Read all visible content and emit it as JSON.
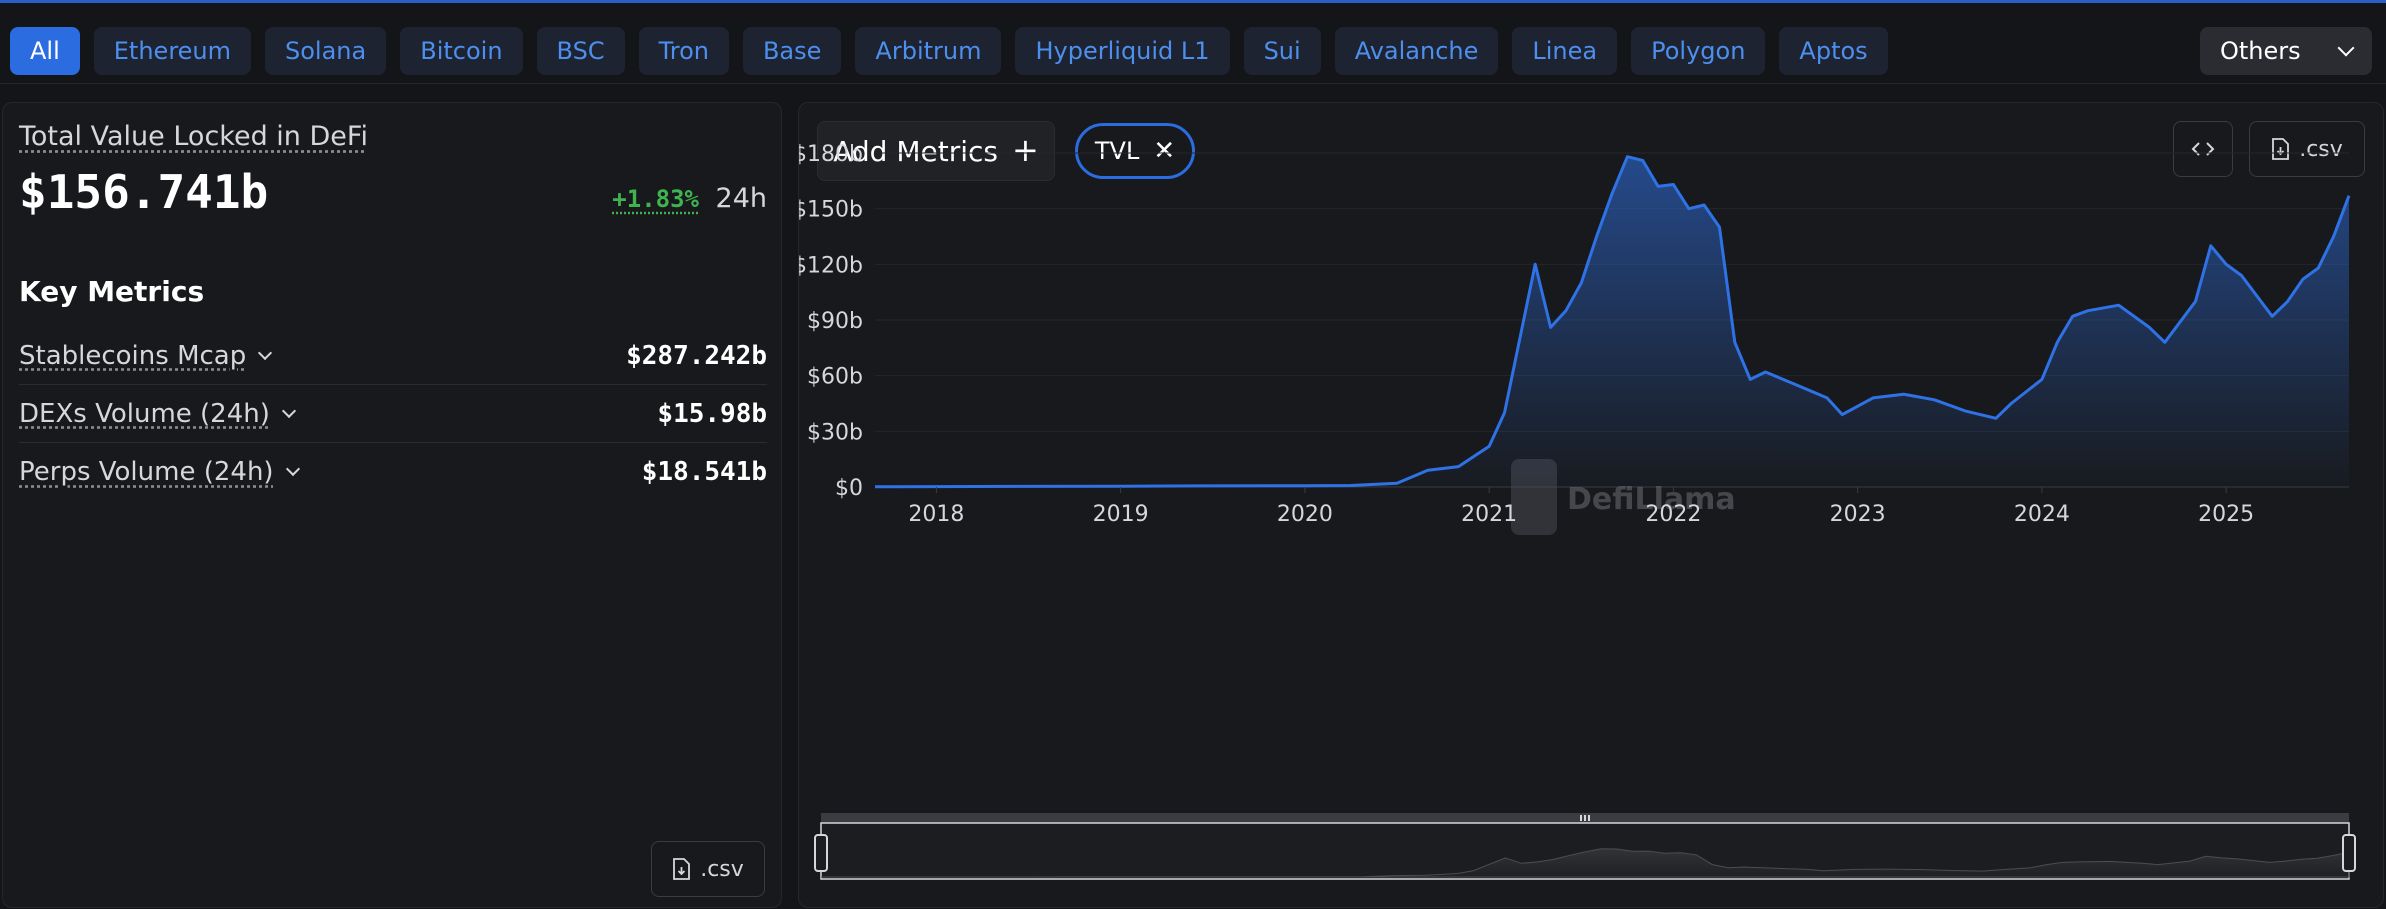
{
  "chains": {
    "items": [
      "All",
      "Ethereum",
      "Solana",
      "Bitcoin",
      "BSC",
      "Tron",
      "Base",
      "Arbitrum",
      "Hyperliquid L1",
      "Sui",
      "Avalanche",
      "Linea",
      "Polygon",
      "Aptos"
    ],
    "active": "All",
    "others_label": "Others"
  },
  "summary": {
    "tvl_label": "Total Value Locked in DeFi",
    "tvl_value": "$156.741b",
    "change": "+1.83%",
    "period": "24h"
  },
  "key_metrics": {
    "title": "Key Metrics",
    "rows": [
      {
        "name": "Stablecoins Mcap",
        "value": "$287.242b"
      },
      {
        "name": "DEXs Volume (24h)",
        "value": "$15.98b"
      },
      {
        "name": "Perps Volume (24h)",
        "value": "$18.541b"
      }
    ]
  },
  "buttons": {
    "csv_label": ".csv",
    "add_metrics_label": "Add Metrics",
    "tvl_chip_label": "TVL"
  },
  "icons": {
    "download": "download-file-icon",
    "embed": "code-brackets-icon",
    "plus": "plus-icon",
    "close": "close-icon",
    "chevron": "chevron-down-icon"
  },
  "colors": {
    "accent": "#2b6de0",
    "line": "#2f72e6",
    "positive": "#3fb34f",
    "tab_text": "#4d8fee"
  },
  "watermark": "DefiLlama",
  "chart_data": {
    "type": "area",
    "series": [
      {
        "name": "TVL",
        "x": [
          "2017-09",
          "2018-01",
          "2018-06",
          "2019-01",
          "2019-06",
          "2020-01",
          "2020-04",
          "2020-07",
          "2020-09",
          "2020-11",
          "2021-01",
          "2021-02",
          "2021-04",
          "2021-05",
          "2021-06",
          "2021-07",
          "2021-08",
          "2021-09",
          "2021-10",
          "2021-11",
          "2021-12",
          "2022-01",
          "2022-02",
          "2022-03",
          "2022-04",
          "2022-05",
          "2022-06",
          "2022-07",
          "2022-09",
          "2022-11",
          "2022-12",
          "2023-02",
          "2023-04",
          "2023-06",
          "2023-08",
          "2023-10",
          "2023-11",
          "2024-01",
          "2024-02",
          "2024-03",
          "2024-04",
          "2024-06",
          "2024-08",
          "2024-09",
          "2024-11",
          "2024-12",
          "2025-01",
          "2025-02",
          "2025-04",
          "2025-05",
          "2025-06",
          "2025-07",
          "2025-08",
          "2025-09"
        ],
        "y": [
          0.1,
          0.2,
          0.3,
          0.4,
          0.6,
          0.7,
          0.8,
          2,
          9,
          11,
          22,
          40,
          120,
          86,
          95,
          110,
          135,
          158,
          178,
          176,
          162,
          163,
          150,
          152,
          140,
          78,
          58,
          62,
          55,
          48,
          39,
          48,
          50,
          47,
          41,
          37,
          45,
          58,
          78,
          92,
          95,
          98,
          86,
          78,
          100,
          130,
          120,
          114,
          92,
          100,
          112,
          118,
          135,
          157
        ]
      }
    ],
    "x_ticks": [
      "2018",
      "2019",
      "2020",
      "2021",
      "2022",
      "2023",
      "2024",
      "2025"
    ],
    "y_ticks": [
      "$0",
      "$30b",
      "$60b",
      "$90b",
      "$120b",
      "$150b",
      "$180b"
    ],
    "ylim": [
      0,
      180
    ],
    "xlim": [
      "2017-09",
      "2025-09"
    ],
    "grid": true,
    "legend": false
  }
}
